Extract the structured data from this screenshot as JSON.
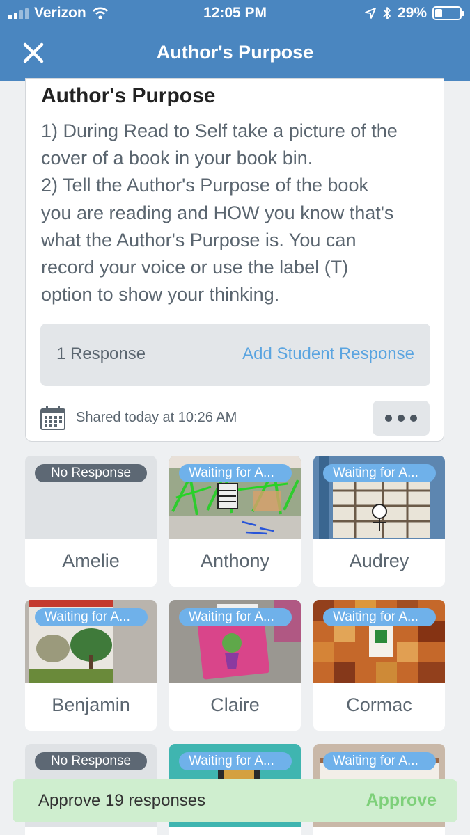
{
  "status_bar": {
    "carrier": "Verizon",
    "time": "12:05 PM",
    "battery": "29%",
    "battery_level": 0.29,
    "icons": [
      "signal-icon",
      "wifi-icon",
      "location-icon",
      "bluetooth-icon",
      "battery-icon"
    ]
  },
  "nav": {
    "title": "Author's Purpose",
    "close_icon": "close-icon"
  },
  "activity": {
    "title": "Author's Purpose",
    "instructions": "1) During Read to Self take a picture of the\ncover of a book in your book bin.\n2) Tell the Author's Purpose of the book\nyou are reading and HOW you know that's\nwhat the Author's Purpose is. You can\nrecord your voice or use the label (T)\noption to show your thinking.",
    "response_count": "1 Response",
    "add_response_label": "Add Student Response",
    "shared_text": "Shared today at 10:26 AM",
    "more_icon": "more-icon"
  },
  "students": [
    {
      "name": "Amelie",
      "status": "No Response"
    },
    {
      "name": "Anthony",
      "status": "Waiting for A..."
    },
    {
      "name": "Audrey",
      "status": "Waiting for A..."
    },
    {
      "name": "Benjamin",
      "status": "Waiting for A..."
    },
    {
      "name": "Claire",
      "status": "Waiting for A..."
    },
    {
      "name": "Cormac",
      "status": "Waiting for A..."
    },
    {
      "name": "",
      "status": "No Response"
    },
    {
      "name": "",
      "status": "Waiting for A..."
    },
    {
      "name": "",
      "status": "Waiting for A..."
    }
  ],
  "approve": {
    "text": "Approve 19 responses",
    "button_label": "Approve"
  },
  "colors": {
    "brand_blue": "#4a86c0",
    "link_blue": "#5aa4e0",
    "badge_waiting": "#6fb1ea",
    "badge_none": "#5d6874",
    "approve_green": "#7ed07a",
    "approve_bg": "#cfeecf"
  }
}
